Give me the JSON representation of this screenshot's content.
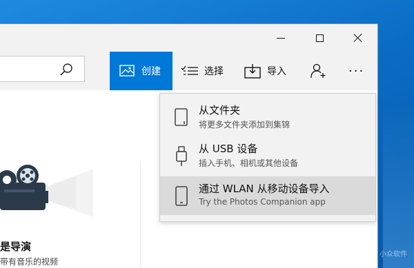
{
  "window": {
    "controls": {
      "minimize": "minimize",
      "maximize": "maximize",
      "close": "close"
    }
  },
  "toolbar": {
    "search_icon": "search-icon",
    "create_label": "创建",
    "select_label": "选择",
    "import_label": "导入",
    "more_label": "···"
  },
  "card": {
    "title": "是导演",
    "subtitle": "带有音乐的视频"
  },
  "import_menu": {
    "items": [
      {
        "title": "从文件夹",
        "subtitle": "将更多文件夹添加到集锦",
        "icon": "folder-device-icon"
      },
      {
        "title": "从 USB 设备",
        "subtitle": "插入手机、相机或其他设备",
        "icon": "usb-icon"
      },
      {
        "title": "通过 WLAN 从移动设备导入",
        "subtitle": "Try the Photos Companion app",
        "icon": "phone-icon",
        "highlighted": true
      }
    ]
  },
  "watermark": "小众软件",
  "colors": {
    "accent": "#0078d7",
    "chrome": "#f2f2f2",
    "highlight": "#dadada"
  }
}
